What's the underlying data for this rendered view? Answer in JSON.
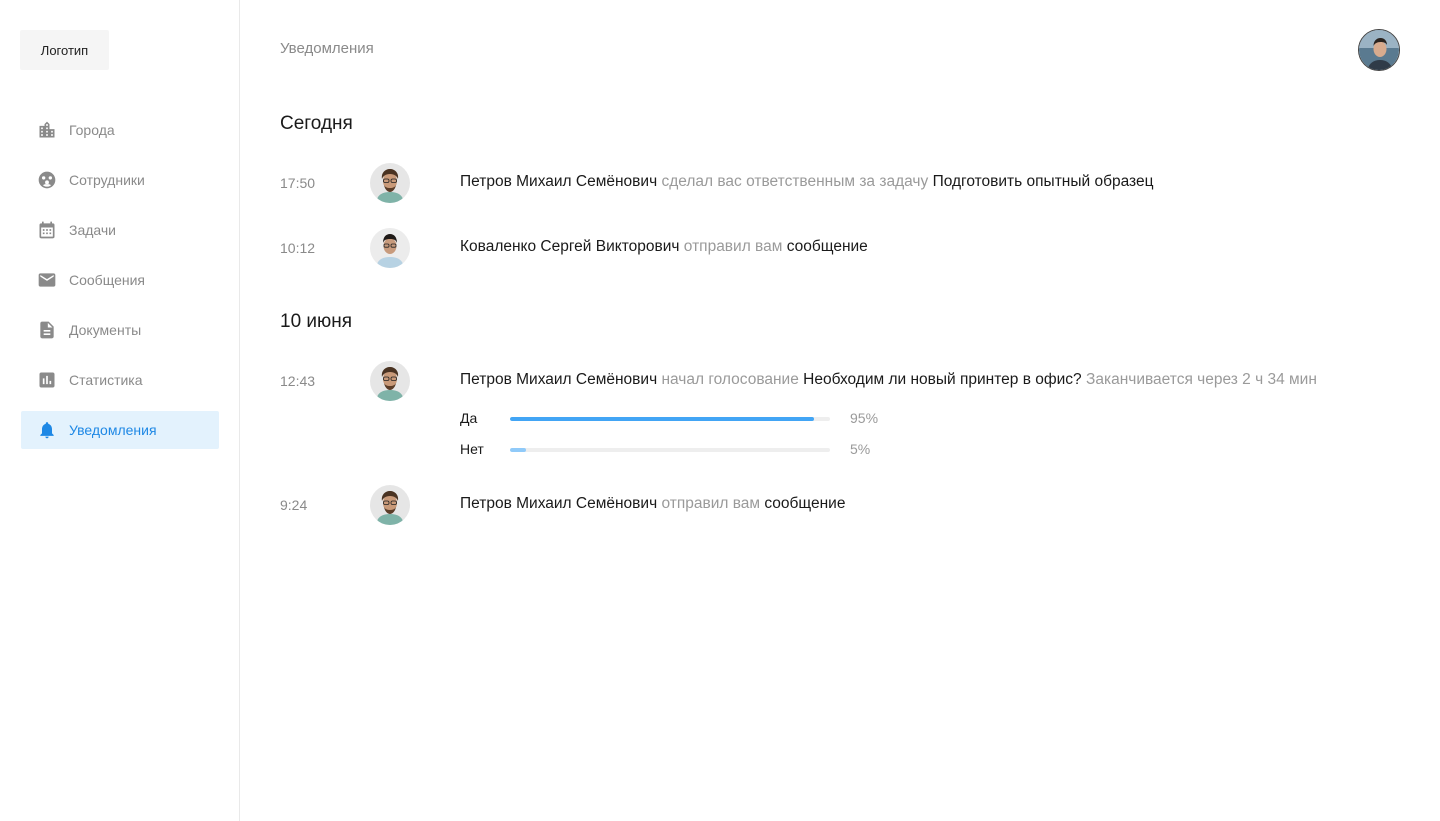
{
  "logo": "Логотип",
  "sidebar": {
    "items": [
      {
        "label": "Города",
        "icon": "city-icon"
      },
      {
        "label": "Сотрудники",
        "icon": "employees-icon"
      },
      {
        "label": "Задачи",
        "icon": "calendar-icon"
      },
      {
        "label": "Сообщения",
        "icon": "mail-icon"
      },
      {
        "label": "Документы",
        "icon": "document-icon"
      },
      {
        "label": "Статистика",
        "icon": "chart-icon"
      },
      {
        "label": "Уведомления",
        "icon": "bell-icon",
        "active": true
      }
    ]
  },
  "header": {
    "title": "Уведомления"
  },
  "colors": {
    "accent": "#1e88e5",
    "active_bg": "#e3f2fd",
    "muted": "#8a8a8a",
    "poll_yes": "#42a5f5",
    "poll_no": "#90caf9"
  },
  "groups": [
    {
      "title": "Сегодня",
      "items": [
        {
          "time": "17:50",
          "author": "Петров Михаил Семёнович",
          "action": "сделал вас ответственным за задачу",
          "object": "Подготовить опытный образец"
        },
        {
          "time": "10:12",
          "author": "Коваленко Сергей Викторович",
          "action": "отправил вам",
          "object": "сообщение"
        }
      ]
    },
    {
      "title": "10 июня",
      "items": [
        {
          "time": "12:43",
          "author": "Петров Михаил Семёнович",
          "action": "начал голосование",
          "object": "Необходим ли новый принтер в офис?",
          "note": "Заканчивается через 2 ч 34 мин",
          "poll": [
            {
              "option": "Да",
              "percent_label": "95%",
              "value": 0.95
            },
            {
              "option": "Нет",
              "percent_label": "5%",
              "value": 0.05
            }
          ]
        },
        {
          "time": "9:24",
          "author": "Петров Михаил Семёнович",
          "action": "отправил вам",
          "object": "сообщение"
        }
      ]
    }
  ]
}
